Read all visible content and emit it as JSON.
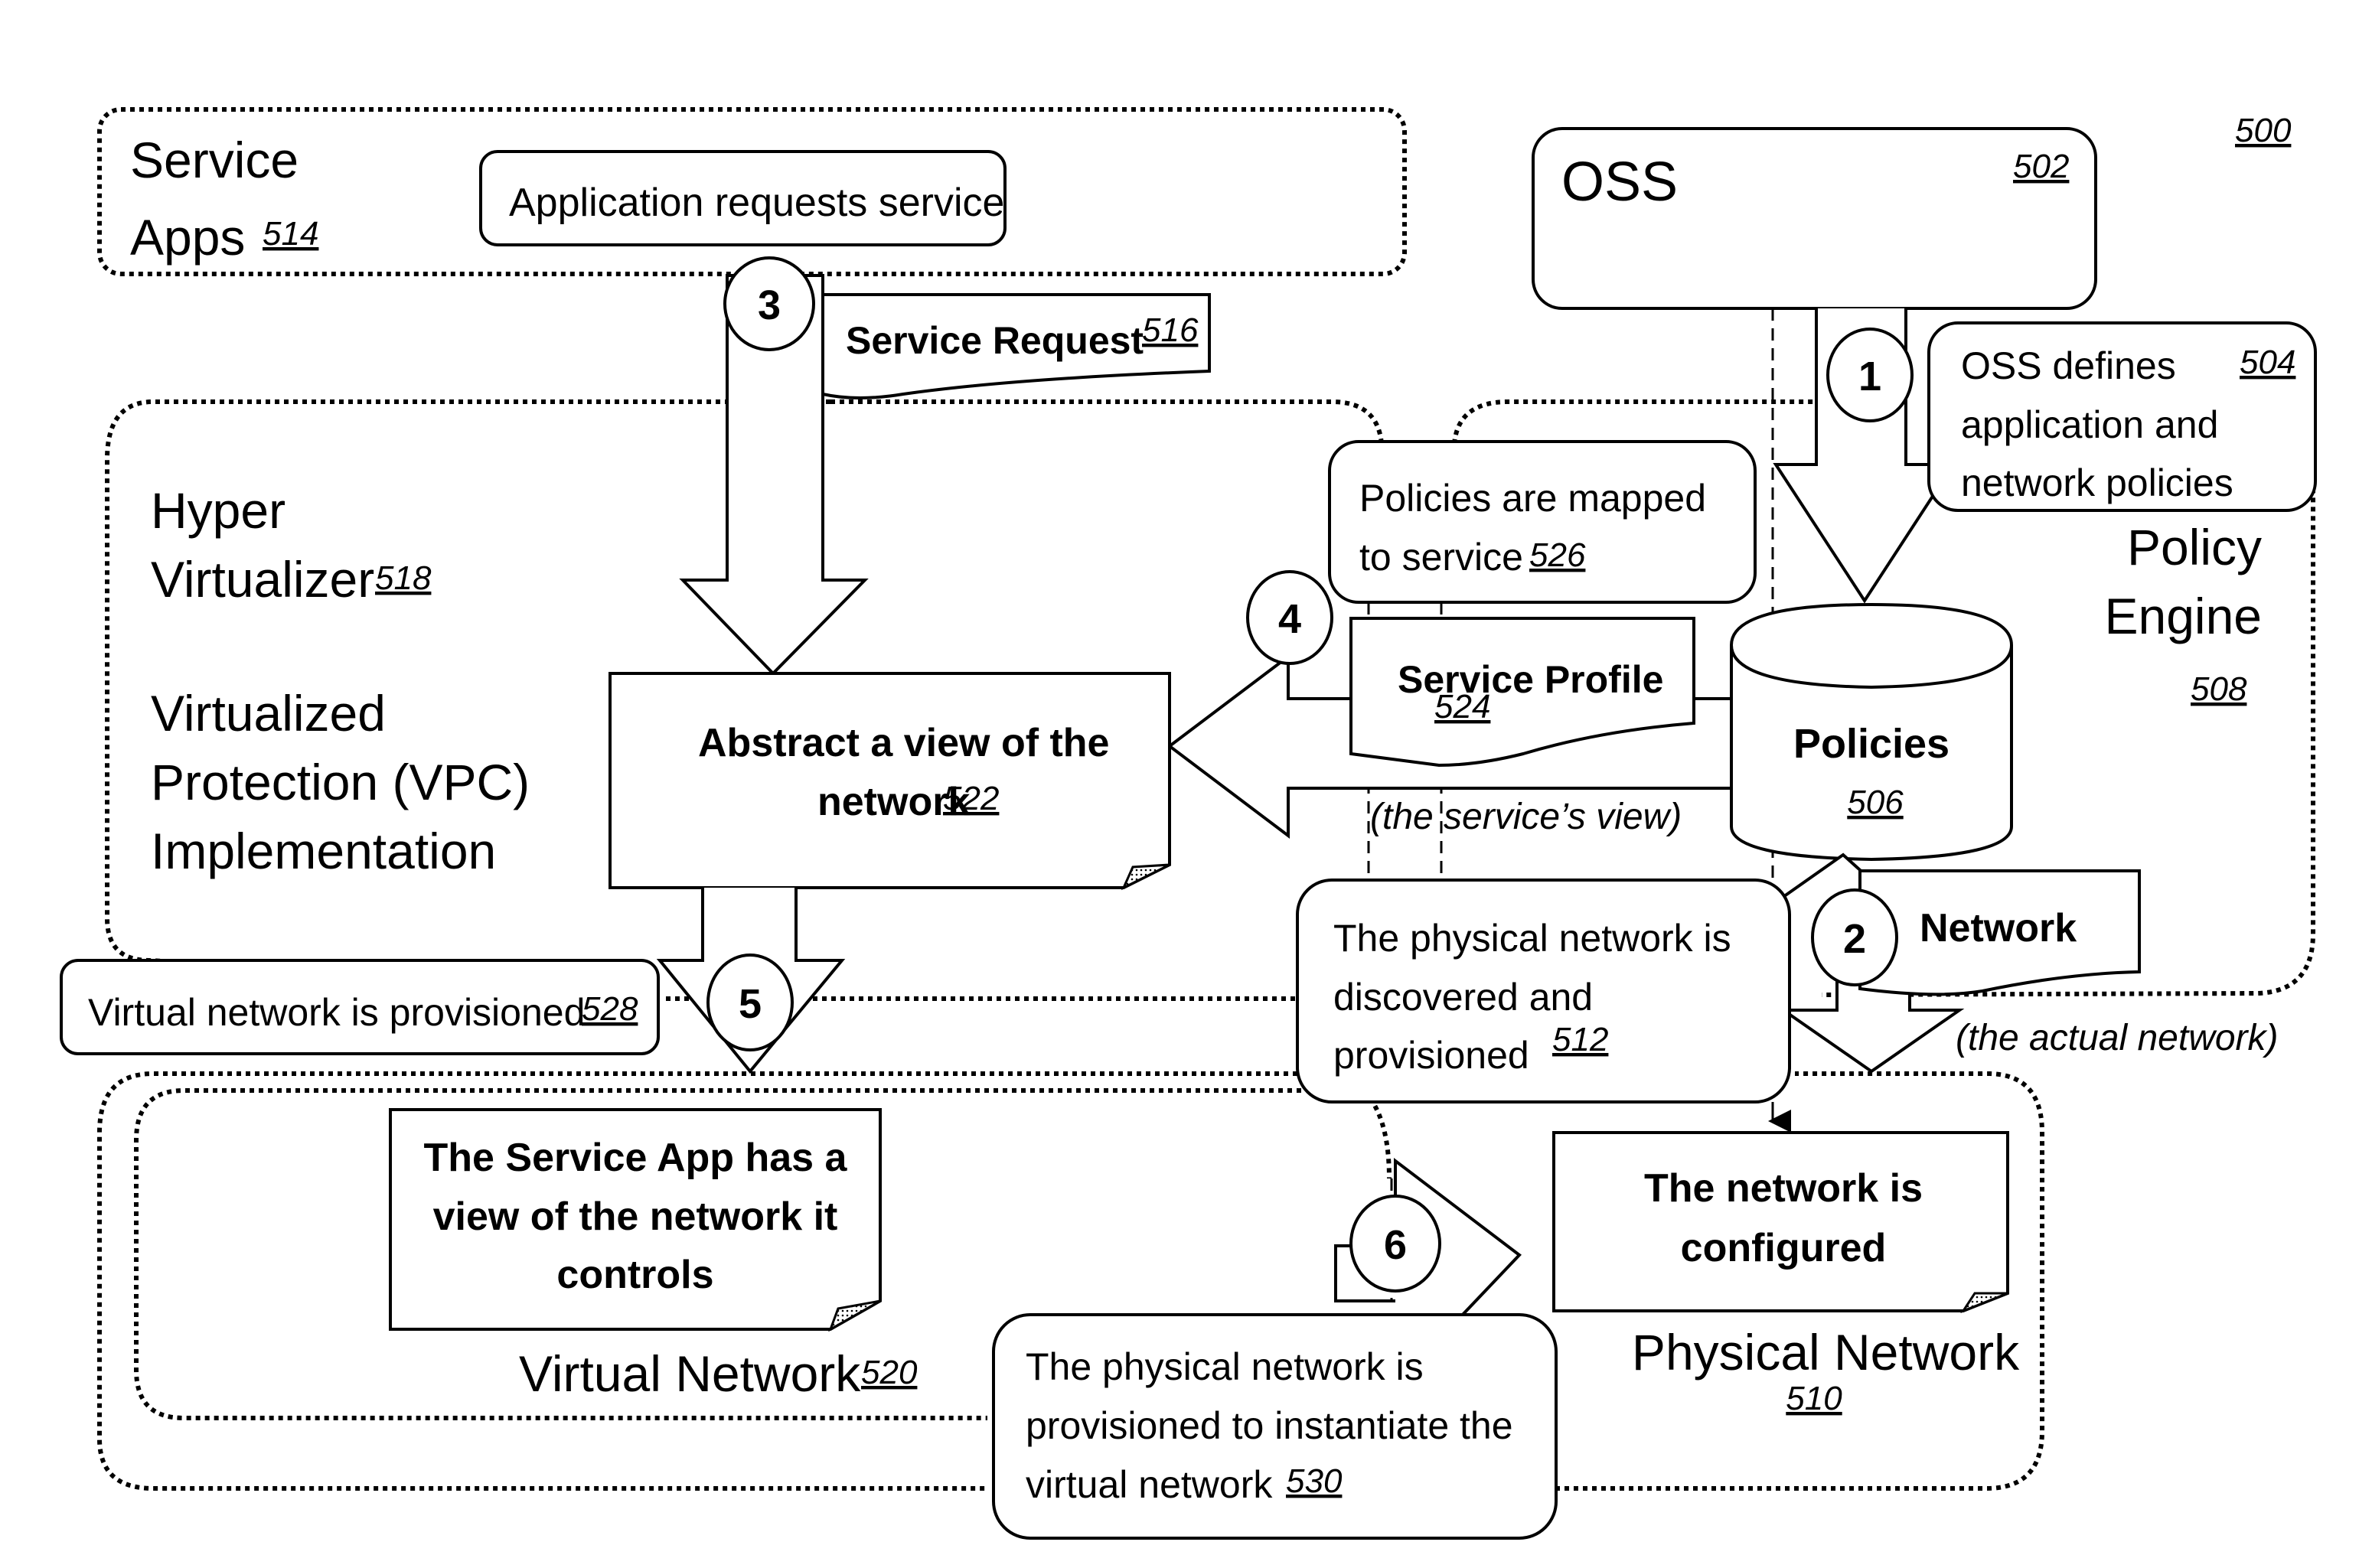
{
  "figure_ref": "500",
  "groups": {
    "service_apps": {
      "label_line1": "Service",
      "label_line2": "Apps",
      "ref": "514"
    },
    "hyper_virtualizer": {
      "label_line1": "Hyper",
      "label_line2": "Virtualizer",
      "ref": "518",
      "sub_line1": "Virtualized",
      "sub_line2": "Protection (VPC)",
      "sub_line3": "Implementation"
    },
    "policy_engine": {
      "label_line1": "Policy",
      "label_line2": "Engine",
      "ref": "508"
    },
    "virtual_network": {
      "label": "Virtual Network",
      "ref": "520"
    },
    "physical_network": {
      "label": "Physical Network",
      "ref": "510"
    }
  },
  "nodes": {
    "oss": {
      "label": "OSS",
      "ref": "502"
    },
    "app_requests": {
      "label": "Application requests service"
    },
    "service_request": {
      "label": "Service Request",
      "ref": "516"
    },
    "oss_defines": {
      "line1": "OSS defines",
      "line2": "application  and",
      "line3": "network policies",
      "ref": "504"
    },
    "policies_mapped": {
      "line1": "Policies are mapped",
      "line2": "to service",
      "ref": "526"
    },
    "service_profile": {
      "label": "Service Profile",
      "ref": "524"
    },
    "policies_db": {
      "label": "Policies",
      "ref": "506"
    },
    "abstract_view": {
      "line1": "Abstract a view of the",
      "line2": "network",
      "ref": "522"
    },
    "services_view": {
      "label": "(the service’s view)"
    },
    "physical_discovered": {
      "line1": "The physical network is",
      "line2": "discovered and",
      "line3": "provisioned",
      "ref": "512"
    },
    "network_doc": {
      "label": "Network"
    },
    "actual_network": {
      "label": "(the actual network)"
    },
    "virtual_provisioned": {
      "label": "Virtual network is provisioned",
      "ref": "528"
    },
    "service_app_view": {
      "line1": "The Service App has a",
      "line2": "view of the network it",
      "line3": "controls"
    },
    "network_configured": {
      "line1": "The network is",
      "line2": "configured"
    },
    "physical_provisioned": {
      "line1": "The physical network is",
      "line2": "provisioned to instantiate the",
      "line3": "virtual network",
      "ref": "530"
    }
  },
  "steps": [
    "1",
    "2",
    "3",
    "4",
    "5",
    "6"
  ]
}
